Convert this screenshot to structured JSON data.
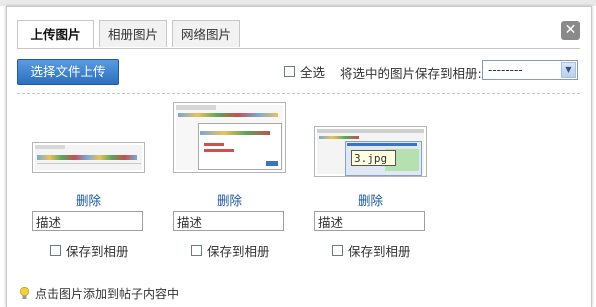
{
  "tabs": [
    {
      "label": "上传图片",
      "active": true
    },
    {
      "label": "相册图片",
      "active": false
    },
    {
      "label": "网络图片",
      "active": false
    }
  ],
  "close_icon": "close-icon",
  "upload_button_label": "选择文件上传",
  "select_all_label": "全选",
  "save_selected_label": "将选中的图片保存到相册:",
  "album_select": {
    "selected": "--------"
  },
  "items": [
    {
      "delete_label": "删除",
      "description_value": "描述",
      "save_label": "保存到相册"
    },
    {
      "delete_label": "删除",
      "description_value": "描述",
      "save_label": "保存到相册"
    },
    {
      "delete_label": "删除",
      "description_value": "描述",
      "save_label": "保存到相册"
    }
  ],
  "tooltip_text": "3.jpg",
  "tip_text": "点击图片添加到帖子内容中",
  "colors": {
    "accent_blue": "#2c6fc0",
    "link_blue": "#1a55a0"
  }
}
